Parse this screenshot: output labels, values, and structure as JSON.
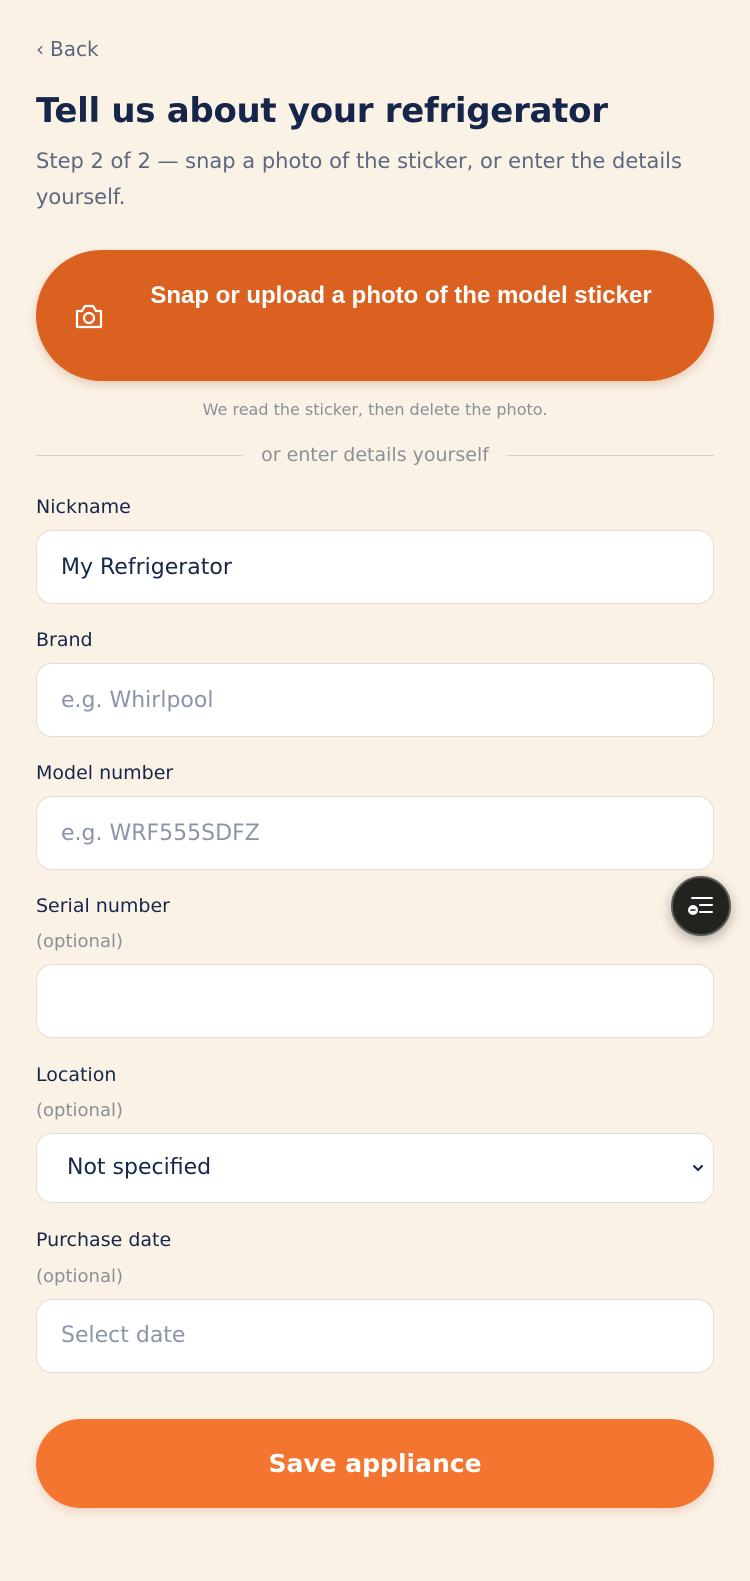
{
  "nav": {
    "back_label": "Back",
    "back_chevron": "‹"
  },
  "header": {
    "title": "Tell us about your refrigerator",
    "subtitle": "Step 2 of 2 — snap a photo of the sticker, or enter the details yourself."
  },
  "photo": {
    "button_label": "Snap or upload a photo of the model sticker",
    "icon": "camera-icon",
    "note": "We read the sticker, then delete the photo.",
    "divider_text": "or enter details yourself"
  },
  "form": {
    "nickname": {
      "label": "Nickname",
      "value": "My Refrigerator",
      "placeholder": ""
    },
    "brand": {
      "label": "Brand",
      "value": "",
      "placeholder": "e.g. Whirlpool"
    },
    "model_number": {
      "label": "Model number",
      "value": "",
      "placeholder": "e.g. WRF555SDFZ"
    },
    "serial_number": {
      "label": "Serial number",
      "optional": "(optional)",
      "value": "",
      "placeholder": ""
    },
    "location": {
      "label": "Location",
      "optional": "(optional)",
      "selected": "Not specified"
    },
    "purchase_date": {
      "label": "Purchase date",
      "optional": "(optional)",
      "placeholder": "Select date"
    }
  },
  "actions": {
    "save_label": "Save appliance"
  },
  "colors": {
    "background": "#fbf2e6",
    "primary_dark": "#db6120",
    "primary": "#f47530",
    "text": "#15264a",
    "muted": "#5d6780"
  },
  "floating": {
    "icon": "assistant-list-icon"
  }
}
